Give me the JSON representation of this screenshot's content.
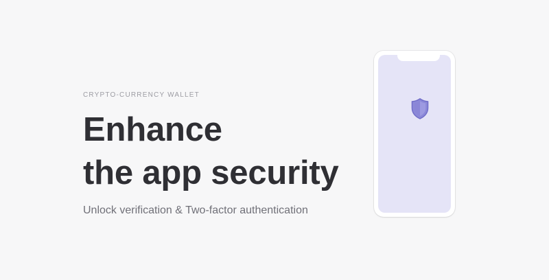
{
  "hero": {
    "eyebrow": "CRYPTO-CURRENCY WALLET",
    "headline_line_1": "Enhance",
    "headline_line_2": "the app security",
    "subtitle": "Unlock verification & Two-factor authentication"
  },
  "illustration": {
    "device": "phone",
    "icon": "shield-icon"
  },
  "colors": {
    "background": "#f7f7f8",
    "headline": "#2f2f34",
    "subtitle": "#707078",
    "eyebrow": "#9c9ca3",
    "phone_screen": "#e5e4f7",
    "shield_fill": "#8b88d8",
    "shield_stroke": "#6f6cc8"
  }
}
